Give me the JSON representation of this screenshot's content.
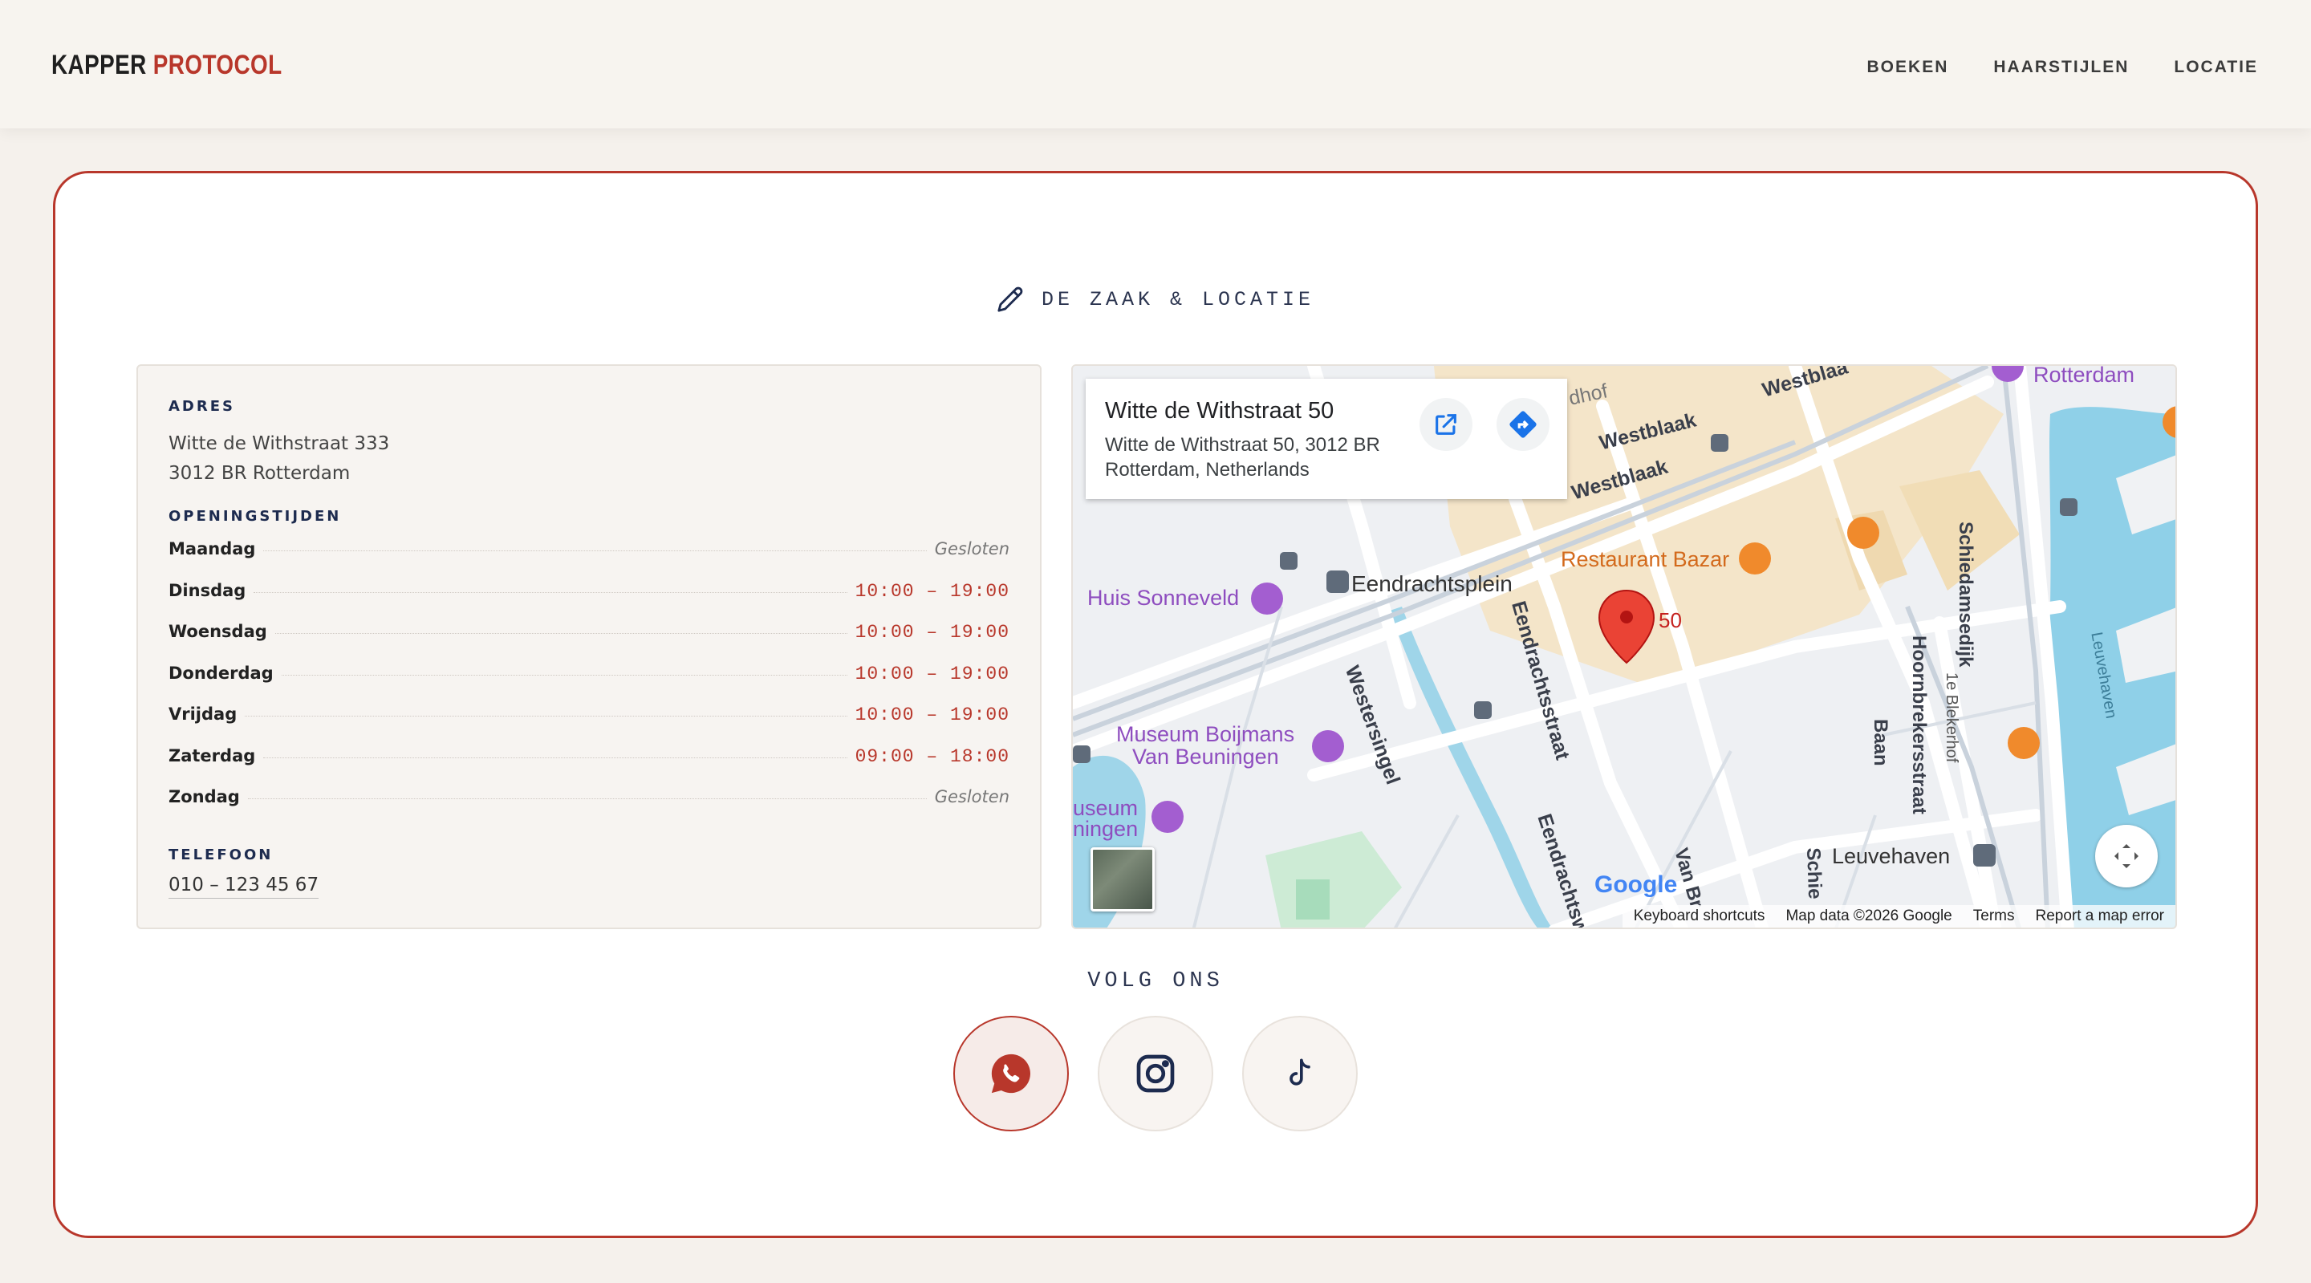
{
  "header": {
    "logo_part1": "KAPPER ",
    "logo_part2": "PROTOCOL",
    "nav": [
      "BOEKEN",
      "HAARSTIJLEN",
      "LOCATIE"
    ]
  },
  "section": {
    "title": "DE ZAAK & LOCATIE",
    "icon": "pencil-icon"
  },
  "info": {
    "address_heading": "ADRES",
    "address_line1": "Witte de Withstraat 333",
    "address_line2": "3012 BR Rotterdam",
    "hours_heading": "OPENINGSTIJDEN",
    "hours": [
      {
        "day": "Maandag",
        "value": "Gesloten",
        "closed": true
      },
      {
        "day": "Dinsdag",
        "value": "10:00 – 19:00",
        "closed": false
      },
      {
        "day": "Woensdag",
        "value": "10:00 – 19:00",
        "closed": false
      },
      {
        "day": "Donderdag",
        "value": "10:00 – 19:00",
        "closed": false
      },
      {
        "day": "Vrijdag",
        "value": "10:00 – 19:00",
        "closed": false
      },
      {
        "day": "Zaterdag",
        "value": "09:00 – 18:00",
        "closed": false
      },
      {
        "day": "Zondag",
        "value": "Gesloten",
        "closed": true
      }
    ],
    "phone_heading": "TELEFOON",
    "phone": "010 – 123 45 67"
  },
  "map": {
    "place_name": "Witte de Withstraat 50",
    "place_address": "Witte de Withstraat 50, 3012 BR Rotterdam, Netherlands",
    "marker_label": "50",
    "labels": {
      "rotterdam": "Rotterdam",
      "westblaak1": "Westblaak",
      "westblaak2": "Westblaak",
      "westblaak3": "Westblaa",
      "eendrachtsplein": "Eendrachtsplein",
      "huis_sonneveld": "Huis Sonneveld",
      "restaurant_bazar": "Restaurant Bazar",
      "westersingel": "Westersingel",
      "eendrachtsstraat": "Eendrachtsstraat",
      "eendrachtsw": "Eendrachtsw",
      "museum1": "Museum Boijmans",
      "museum2": "Van Beuningen",
      "museum_small1": "useum",
      "museum_small2": "ningen",
      "schiedamsedijk": "Schiedamsedijk",
      "hoornbrekersstraat": "Hoornbrekersstraat",
      "blekerhof": "1e Blekerhof",
      "baan": "Baan",
      "leuvehaven": "Leuvehaven",
      "leuvehaven_water": "Leuvehaven",
      "vanbr": "Van Br",
      "schie": "Schie",
      "dhof": "dhof"
    },
    "attribution": [
      "Keyboard shortcuts",
      "Map data ©2026 Google",
      "Terms",
      "Report a map error"
    ],
    "google": "Google"
  },
  "social": {
    "title": "VOLG ONS",
    "items": [
      "whatsapp-icon",
      "instagram-icon",
      "tiktok-icon"
    ]
  },
  "colors": {
    "accent": "#b8372b",
    "navy": "#1d2b4f"
  }
}
